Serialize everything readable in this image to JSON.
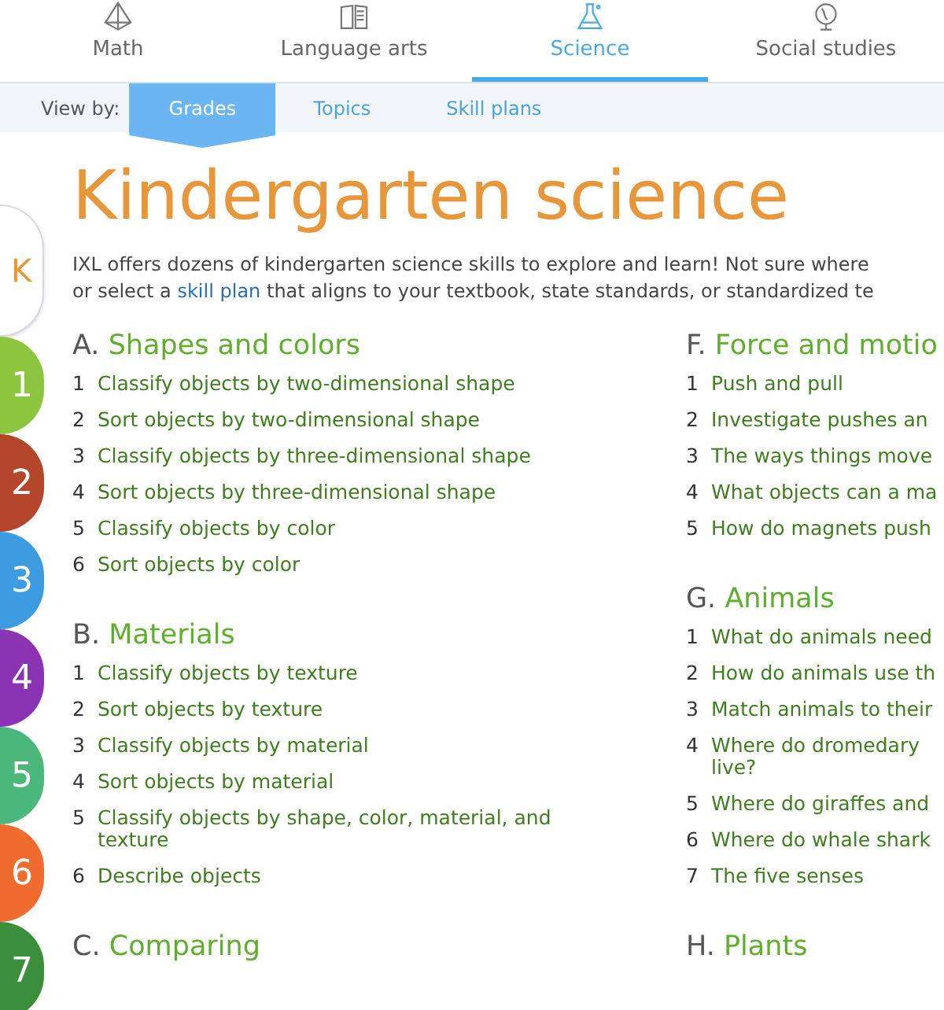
{
  "subjects": [
    {
      "label": "Math",
      "selected": false
    },
    {
      "label": "Language arts",
      "selected": false
    },
    {
      "label": "Science",
      "selected": true
    },
    {
      "label": "Social studies",
      "selected": false
    }
  ],
  "view_by": {
    "label": "View by:",
    "options": [
      {
        "label": "Grades",
        "selected": true
      },
      {
        "label": "Topics",
        "selected": false
      },
      {
        "label": "Skill plans",
        "selected": false
      }
    ]
  },
  "grades": [
    {
      "label": "K",
      "color": "#ffffff",
      "selected": true
    },
    {
      "label": "1",
      "color": "#8cc63f",
      "selected": false
    },
    {
      "label": "2",
      "color": "#b4462b",
      "selected": false
    },
    {
      "label": "3",
      "color": "#3d9ce0",
      "selected": false
    },
    {
      "label": "4",
      "color": "#8a34b4",
      "selected": false
    },
    {
      "label": "5",
      "color": "#4cb77a",
      "selected": false
    },
    {
      "label": "6",
      "color": "#ef6c2e",
      "selected": false
    },
    {
      "label": "7",
      "color": "#3b8e3a",
      "selected": false
    }
  ],
  "title": "Kindergarten science",
  "intro": {
    "before": "IXL offers dozens of kindergarten science skills to explore and learn! Not sure where",
    "line2_before": "or select a ",
    "link": "skill plan",
    "after": " that aligns to your textbook, state standards, or standardized te"
  },
  "columns": [
    [
      {
        "letter": "A.",
        "name": "Shapes and colors",
        "skills": [
          {
            "number": "1",
            "name": "Classify objects by two-dimensional shape"
          },
          {
            "number": "2",
            "name": "Sort objects by two-dimensional shape"
          },
          {
            "number": "3",
            "name": "Classify objects by three-dimensional shape"
          },
          {
            "number": "4",
            "name": "Sort objects by three-dimensional shape"
          },
          {
            "number": "5",
            "name": "Classify objects by color"
          },
          {
            "number": "6",
            "name": "Sort objects by color"
          }
        ]
      },
      {
        "letter": "B.",
        "name": "Materials",
        "skills": [
          {
            "number": "1",
            "name": "Classify objects by texture"
          },
          {
            "number": "2",
            "name": "Sort objects by texture"
          },
          {
            "number": "3",
            "name": "Classify objects by material"
          },
          {
            "number": "4",
            "name": "Sort objects by material"
          },
          {
            "number": "5",
            "name": "Classify objects by shape, color, material, and texture"
          },
          {
            "number": "6",
            "name": "Describe objects"
          }
        ]
      },
      {
        "letter": "C.",
        "name": "Comparing"
      }
    ],
    [
      {
        "letter": "F.",
        "name": "Force and motio",
        "skills": [
          {
            "number": "1",
            "name": "Push and pull"
          },
          {
            "number": "2",
            "name": "Investigate pushes an"
          },
          {
            "number": "3",
            "name": "The ways things move"
          },
          {
            "number": "4",
            "name": "What objects can a ma"
          },
          {
            "number": "5",
            "name": "How do magnets push"
          }
        ]
      },
      {
        "letter": "G.",
        "name": "Animals",
        "skills": [
          {
            "number": "1",
            "name": "What do animals need"
          },
          {
            "number": "2",
            "name": "How do animals use th"
          },
          {
            "number": "3",
            "name": "Match animals to their"
          },
          {
            "number": "4",
            "name": "Where do dromedary\nlive?"
          },
          {
            "number": "5",
            "name": "Where do giraffes and"
          },
          {
            "number": "6",
            "name": "Where do whale shark"
          },
          {
            "number": "7",
            "name": "The five senses"
          }
        ]
      },
      {
        "letter": "H.",
        "name": "Plants"
      }
    ]
  ]
}
